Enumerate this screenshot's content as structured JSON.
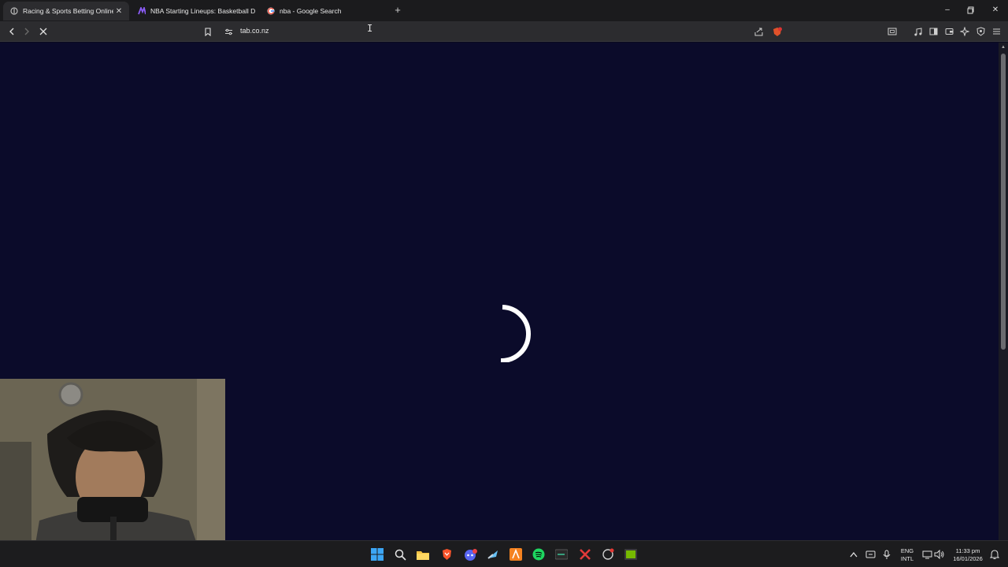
{
  "tabs": [
    {
      "title": "Racing & Sports Betting Online",
      "icon": "tab-favicon",
      "active": true
    },
    {
      "title": "NBA Starting Lineups: Basketball Dai",
      "icon": "rotowire-favicon",
      "active": false
    },
    {
      "title": "nba - Google Search",
      "icon": "google-favicon",
      "active": false
    }
  ],
  "toolbar": {
    "url": "tab.co.nz"
  },
  "taskbar": {
    "lang_line1": "ENG",
    "lang_line2": "INTL",
    "time": "11:33 pm",
    "date": "16/01/2026"
  },
  "colors": {
    "page_bg": "#0b0b2a",
    "tabbar_bg": "#1b1b1d",
    "toolbar_bg": "#2c2c2f",
    "taskbar_bg": "#1c1c1e"
  }
}
